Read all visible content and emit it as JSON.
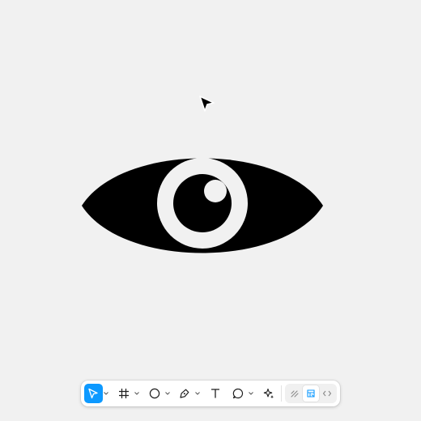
{
  "canvas": {
    "background": "#f1f1f1"
  },
  "artwork": {
    "icon": "eye-icon",
    "fill": "#000000",
    "highlight": "#f1f1f1"
  },
  "cursor": {
    "icon": "cursor-arrow-icon"
  },
  "toolbar": {
    "accent": "#0d99ff",
    "tools": [
      {
        "icon": "move-arrow-icon",
        "active": true,
        "has_menu": true
      },
      {
        "icon": "frame-hash-icon",
        "active": false,
        "has_menu": true
      },
      {
        "icon": "ellipse-icon",
        "active": false,
        "has_menu": true
      },
      {
        "icon": "pen-icon",
        "active": false,
        "has_menu": true
      },
      {
        "icon": "text-icon",
        "active": false,
        "has_menu": false
      },
      {
        "icon": "comment-icon",
        "active": false,
        "has_menu": true
      },
      {
        "icon": "actions-sparkle-icon",
        "active": false,
        "has_menu": false
      }
    ],
    "modes": [
      {
        "icon": "draw-mode-icon",
        "selected": false
      },
      {
        "icon": "design-mode-icon",
        "selected": true
      },
      {
        "icon": "dev-mode-icon",
        "selected": false
      }
    ]
  }
}
